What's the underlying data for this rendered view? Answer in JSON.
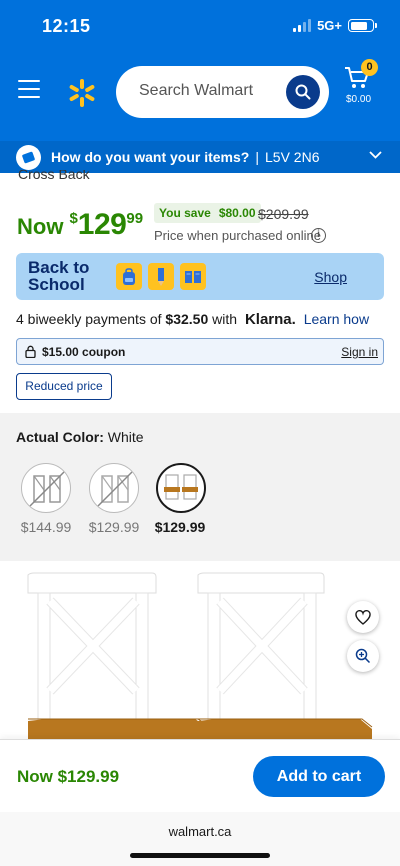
{
  "status_bar": {
    "time": "12:15",
    "network": "5G+"
  },
  "header": {
    "search_placeholder": "Search Walmart",
    "cart_count": "0",
    "cart_total": "$0.00",
    "colors": {
      "brand_blue": "#0071dc",
      "spark_yellow": "#ffc220"
    }
  },
  "delivery": {
    "question": "How do you want your items?",
    "separator": "|",
    "postal_code": "L5V 2N6"
  },
  "product": {
    "cut_title": "Cross Back",
    "price_now_label": "Now",
    "price_dollar_sign": "$",
    "price_main": "129",
    "price_cents": "99",
    "you_save_label": "You save",
    "you_save_amount": "$80.00",
    "was_price": "$209.99",
    "price_note": "Price when purchased online",
    "info_icon_glyph": "i"
  },
  "back_to_school": {
    "title": "Back to School",
    "shop_label": "Shop"
  },
  "klarna": {
    "text_prefix": "4 biweekly payments of",
    "amount": "$32.50",
    "text_with": "with",
    "logo": "Klarna.",
    "link": "Learn how"
  },
  "coupon": {
    "label": "$15.00 coupon",
    "signin": "Sign in"
  },
  "reduced_badge": "Reduced price",
  "color_picker": {
    "label": "Actual Color:",
    "value": "White",
    "swatches": [
      {
        "price": "$144.99",
        "available": false
      },
      {
        "price": "$129.99",
        "available": false
      },
      {
        "price": "$129.99",
        "selected": true
      }
    ]
  },
  "bottom_bar": {
    "price": "Now $129.99",
    "add_to_cart": "Add to cart"
  },
  "browser": {
    "url": "walmart.ca"
  }
}
